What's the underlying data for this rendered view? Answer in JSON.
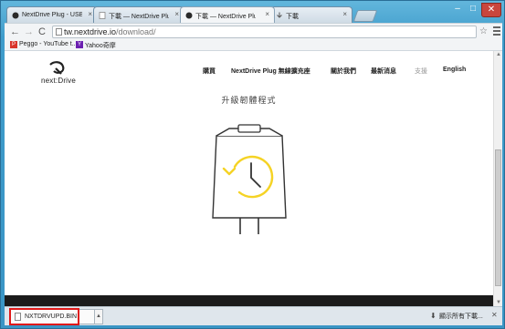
{
  "tabs": [
    {
      "title": "NextDrive Plug - USB W",
      "active": false
    },
    {
      "title": "下載 — NextDrive Plug ·",
      "active": false
    },
    {
      "title": "下載 — NextDrive Plug ·",
      "active": true
    },
    {
      "title": "下載",
      "active": false
    }
  ],
  "toolbar": {
    "back": "←",
    "forward": "→",
    "reload": "C",
    "url_host": "tw.nextdrive.io",
    "url_path": "/download/",
    "star": "☆"
  },
  "bookmarks": [
    {
      "label": "Peggo - YouTube t...",
      "icon": "P",
      "color": "#d9342b"
    },
    {
      "label": "Yahoo奇摩",
      "icon": "Y",
      "color": "#6b1fb0"
    }
  ],
  "site": {
    "logo_text": "next:Drive",
    "nav": [
      "購買",
      "NextDrive Plug 無線擴充座",
      "關於我們",
      "最新消息",
      "支援",
      "English"
    ],
    "heading": "升級韌體程式"
  },
  "download_shelf": {
    "filename": "NXTDRVUPD.BIN",
    "show_all": "顯示所有下載...",
    "close": "✕"
  },
  "colors": {
    "accent_yellow": "#f5d325",
    "window_frame": "#3e9bc7",
    "highlight_red": "#e01818"
  }
}
